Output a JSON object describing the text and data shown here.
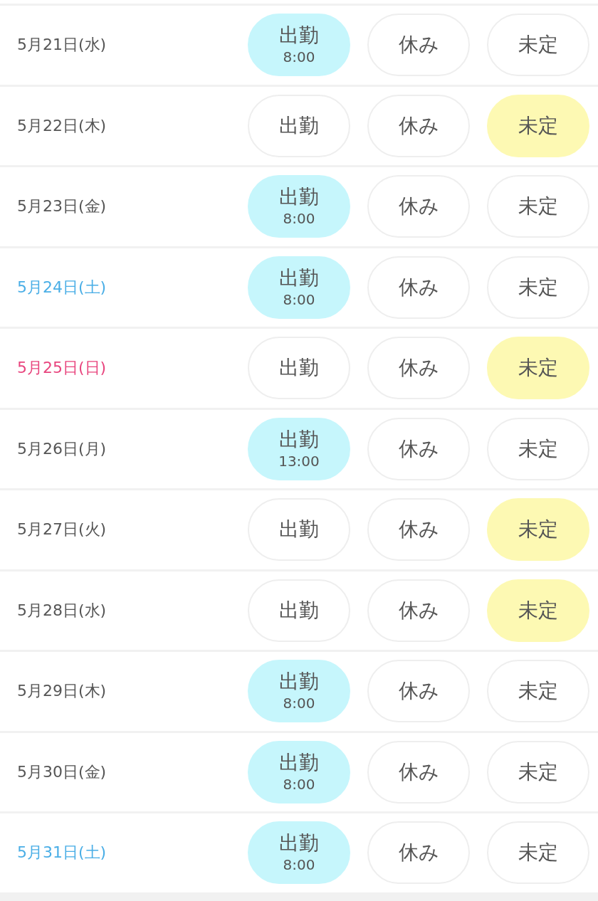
{
  "rows": [
    {
      "date": "5月21日(水)",
      "kind": "weekday",
      "options": [
        {
          "kind": "work",
          "label": "出勤",
          "time": "8:00",
          "selected": true
        },
        {
          "kind": "off",
          "label": "休み",
          "selected": false
        },
        {
          "kind": "undecided",
          "label": "未定",
          "selected": false
        }
      ]
    },
    {
      "date": "5月22日(木)",
      "kind": "weekday",
      "options": [
        {
          "kind": "work",
          "label": "出勤",
          "selected": false
        },
        {
          "kind": "off",
          "label": "休み",
          "selected": false
        },
        {
          "kind": "undecided",
          "label": "未定",
          "selected": true
        }
      ]
    },
    {
      "date": "5月23日(金)",
      "kind": "weekday",
      "options": [
        {
          "kind": "work",
          "label": "出勤",
          "time": "8:00",
          "selected": true
        },
        {
          "kind": "off",
          "label": "休み",
          "selected": false
        },
        {
          "kind": "undecided",
          "label": "未定",
          "selected": false
        }
      ]
    },
    {
      "date": "5月24日(土)",
      "kind": "saturday",
      "options": [
        {
          "kind": "work",
          "label": "出勤",
          "time": "8:00",
          "selected": true
        },
        {
          "kind": "off",
          "label": "休み",
          "selected": false
        },
        {
          "kind": "undecided",
          "label": "未定",
          "selected": false
        }
      ]
    },
    {
      "date": "5月25日(日)",
      "kind": "sunday",
      "options": [
        {
          "kind": "work",
          "label": "出勤",
          "selected": false
        },
        {
          "kind": "off",
          "label": "休み",
          "selected": false
        },
        {
          "kind": "undecided",
          "label": "未定",
          "selected": true
        }
      ]
    },
    {
      "date": "5月26日(月)",
      "kind": "weekday",
      "options": [
        {
          "kind": "work",
          "label": "出勤",
          "time": "13:00",
          "selected": true
        },
        {
          "kind": "off",
          "label": "休み",
          "selected": false
        },
        {
          "kind": "undecided",
          "label": "未定",
          "selected": false
        }
      ]
    },
    {
      "date": "5月27日(火)",
      "kind": "weekday",
      "options": [
        {
          "kind": "work",
          "label": "出勤",
          "selected": false
        },
        {
          "kind": "off",
          "label": "休み",
          "selected": false
        },
        {
          "kind": "undecided",
          "label": "未定",
          "selected": true
        }
      ]
    },
    {
      "date": "5月28日(水)",
      "kind": "weekday",
      "options": [
        {
          "kind": "work",
          "label": "出勤",
          "selected": false
        },
        {
          "kind": "off",
          "label": "休み",
          "selected": false
        },
        {
          "kind": "undecided",
          "label": "未定",
          "selected": true
        }
      ]
    },
    {
      "date": "5月29日(木)",
      "kind": "weekday",
      "options": [
        {
          "kind": "work",
          "label": "出勤",
          "time": "8:00",
          "selected": true
        },
        {
          "kind": "off",
          "label": "休み",
          "selected": false
        },
        {
          "kind": "undecided",
          "label": "未定",
          "selected": false
        }
      ]
    },
    {
      "date": "5月30日(金)",
      "kind": "weekday",
      "options": [
        {
          "kind": "work",
          "label": "出勤",
          "time": "8:00",
          "selected": true
        },
        {
          "kind": "off",
          "label": "休み",
          "selected": false
        },
        {
          "kind": "undecided",
          "label": "未定",
          "selected": false
        }
      ]
    },
    {
      "date": "5月31日(土)",
      "kind": "saturday",
      "options": [
        {
          "kind": "work",
          "label": "出勤",
          "time": "8:00",
          "selected": true
        },
        {
          "kind": "off",
          "label": "休み",
          "selected": false
        },
        {
          "kind": "undecided",
          "label": "未定",
          "selected": false
        }
      ]
    }
  ]
}
